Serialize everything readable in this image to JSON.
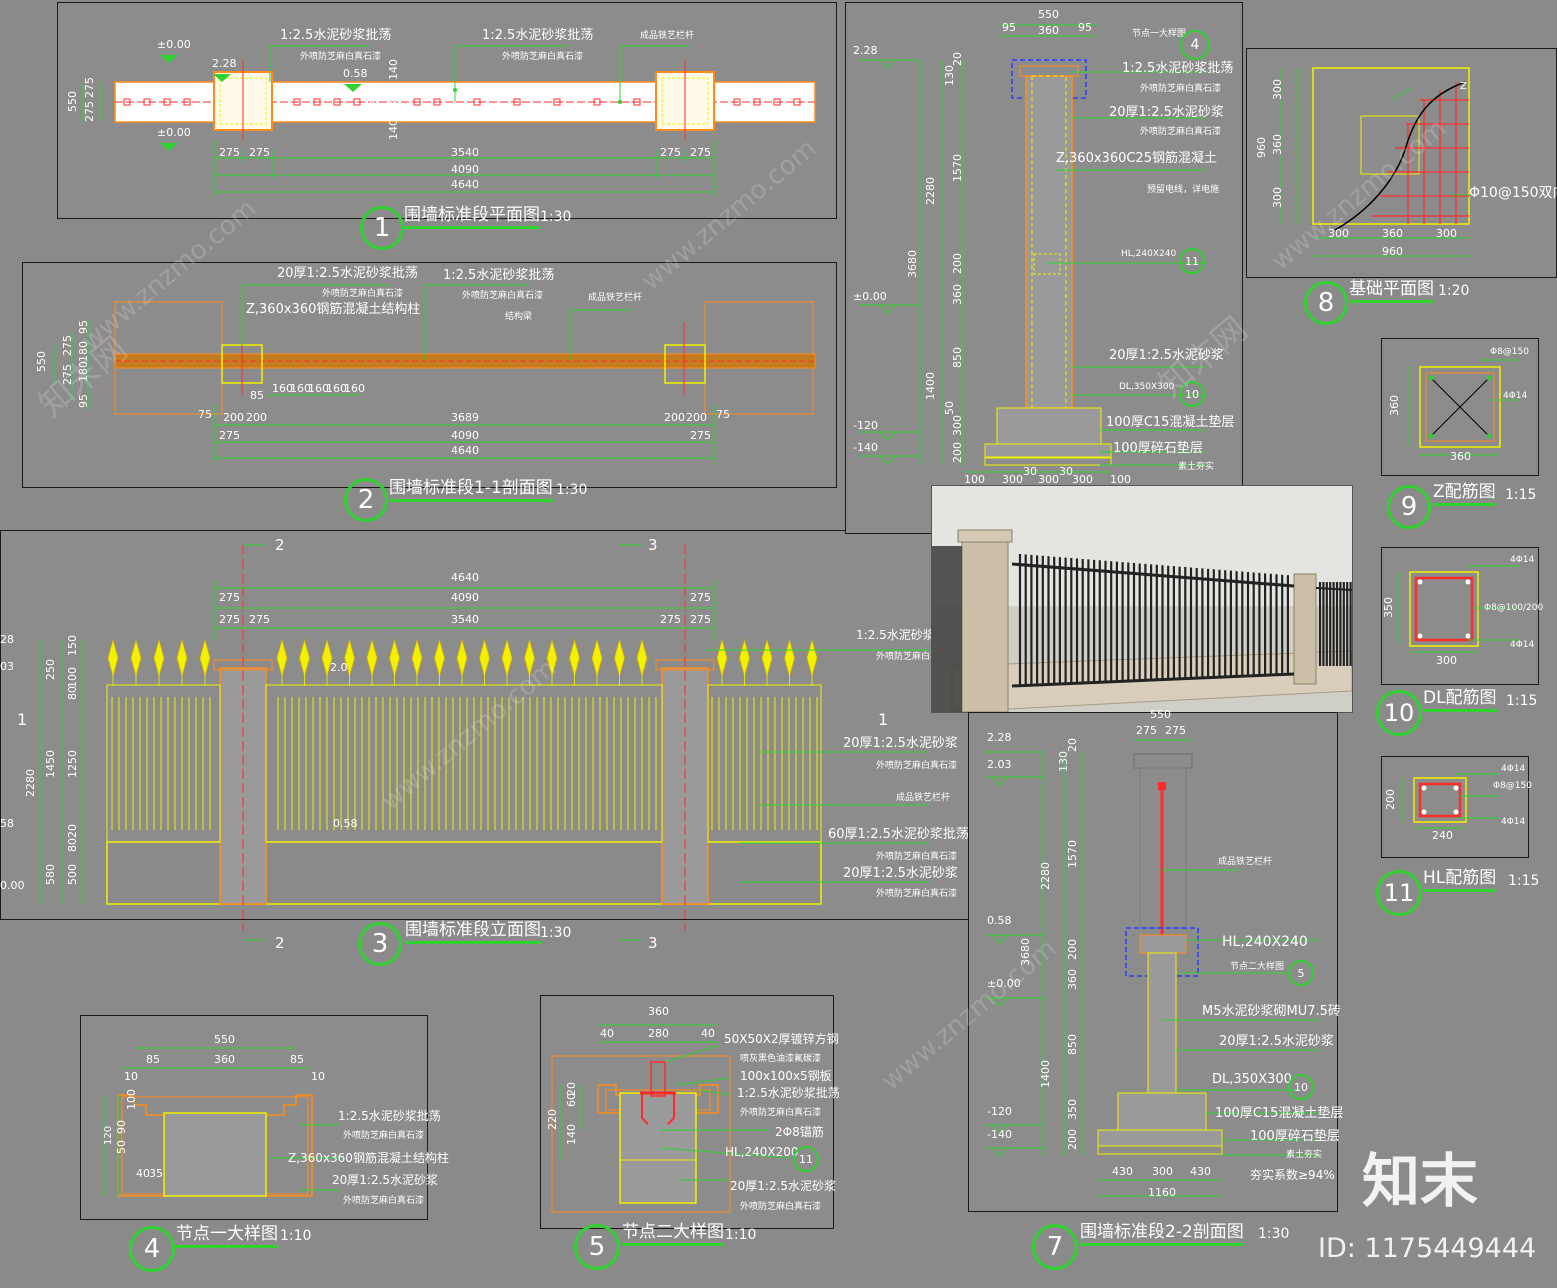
{
  "views": {
    "v1": {
      "number": "1",
      "title": "围墙标准段平面图",
      "scale": "1:30"
    },
    "v2": {
      "number": "2",
      "title": "围墙标准段1-1剖面图",
      "scale": "1:30"
    },
    "v3": {
      "number": "3",
      "title": "围墙标准段立面图",
      "scale": "1:30"
    },
    "v4": {
      "number": "4",
      "title": "节点一大样图",
      "scale": "1:10"
    },
    "v5": {
      "number": "5",
      "title": "节点二大样图",
      "scale": "1:10"
    },
    "v7": {
      "number": "7",
      "title": "围墙标准段2-2剖面图",
      "scale": "1:30"
    },
    "v8": {
      "number": "8",
      "title": "基础平面图",
      "scale": "1:20"
    },
    "v9": {
      "number": "9",
      "title": "Z配筋图",
      "scale": "1:15"
    },
    "v10": {
      "number": "10",
      "title": "DL配筋图",
      "scale": "1:15"
    },
    "v11": {
      "number": "11",
      "title": "HL配筋图",
      "scale": "1:15"
    }
  },
  "plan1": {
    "notes": [
      "1:2.5水泥砂浆批荡",
      "外喷防芝麻白真石漆",
      "1:2.5水泥砂浆批荡",
      "外喷防芝麻白真石漆",
      "成品铁艺栏杆"
    ],
    "levels": [
      "±0.00",
      "2.28",
      "0.58",
      "±0.00"
    ],
    "dims_bottom": [
      "275",
      "275",
      "3540",
      "275",
      "275",
      "4090",
      "4640"
    ],
    "dims_left": [
      "550",
      "275",
      "275"
    ],
    "dims_mid": [
      "140",
      "360",
      "80",
      "140"
    ]
  },
  "sec1": {
    "notes": [
      "20厚1:2.5水泥砂浆批荡",
      "外喷防芝麻白真石漆",
      "Z,360x360钢筋混凝土结构柱",
      "1:2.5水泥砂浆批荡",
      "外喷防芝麻白真石漆",
      "结构梁",
      "成品铁艺栏杆"
    ],
    "dims_left": [
      "550",
      "275",
      "275",
      "95",
      "180",
      "180",
      "95"
    ],
    "dims_bottom": [
      "160",
      "160",
      "160",
      "160",
      "160",
      "85",
      "75",
      "200",
      "200",
      "3689",
      "200",
      "200",
      "75",
      "275",
      "4090",
      "275",
      "4640"
    ]
  },
  "elev3": {
    "cut_marks": [
      "2",
      "3",
      "2",
      "3",
      "1",
      "1"
    ],
    "dims_top": [
      "4640",
      "275",
      "4090",
      "275",
      "275",
      "275",
      "3540",
      "275",
      "275"
    ],
    "dims_left": [
      "28",
      "03",
      "250",
      "150",
      "100",
      "80",
      "1450",
      "1250",
      "20",
      "80",
      "2280",
      "580",
      "500",
      "58",
      "0.00"
    ],
    "levels": [
      "2.0",
      "0.58"
    ],
    "notes": [
      "1:2.5水泥砂浆",
      "外喷防芝麻白石",
      "20厚1:2.5水泥砂浆",
      "外喷防芝麻白真石漆",
      "成品铁艺栏杆",
      "60厚1:2.5水泥砂浆批荡",
      "外喷防芝麻白真石漆",
      "20厚1:2.5水泥砂浆",
      "外喷防芝麻白真石漆"
    ]
  },
  "sec7top": {
    "dims_top": [
      "550",
      "95",
      "360",
      "95"
    ],
    "levels": [
      "2.28",
      "±0.00",
      "-120",
      "-140"
    ],
    "dims_left": [
      "130",
      "20",
      "1570",
      "2280",
      "3680",
      "200",
      "360",
      "850",
      "1400",
      "50",
      "300",
      "200"
    ],
    "dims_bottom": [
      "100",
      "300",
      "300",
      "300",
      "100",
      "30",
      "30"
    ],
    "notes": [
      "节点一大样图",
      "1:2.5水泥砂浆批荡",
      "外喷防芝麻白真石漆",
      "20厚1:2.5水泥砂浆",
      "外喷防芝麻白真石漆",
      "Z,360x360C25钢筋混凝土",
      "预留电线，详电施",
      "HL,240X240",
      "20厚1:2.5水泥砂浆",
      "DL,350X300",
      "100厚C15混凝土垫层",
      "100厚碎石垫层",
      "素土夯实"
    ],
    "tags": [
      "4",
      "11",
      "10"
    ]
  },
  "found8": {
    "dims_left": [
      "960",
      "300",
      "360",
      "300"
    ],
    "dims_bottom": [
      "300",
      "360",
      "300",
      "960"
    ],
    "note": "Φ10@150双向",
    "z": "Z"
  },
  "rebar9": {
    "notes": [
      "Φ8@150",
      "4Φ14"
    ],
    "dims": [
      "360",
      "360"
    ]
  },
  "rebar10": {
    "notes": [
      "4Φ14",
      "Φ8@100/200",
      "4Φ14"
    ],
    "dims": [
      "350",
      "300"
    ]
  },
  "rebar11": {
    "notes": [
      "4Φ14",
      "Φ8@150",
      "4Φ14"
    ],
    "dims": [
      "200",
      "240"
    ]
  },
  "sec22": {
    "dims_top": [
      "550",
      "275",
      "275"
    ],
    "levels": [
      "2.28",
      "2.03",
      "0.58",
      "±0.00",
      "-120",
      "-140"
    ],
    "dims_left": [
      "130",
      "20",
      "1570",
      "2280",
      "3680",
      "200",
      "360",
      "850",
      "1400",
      "350",
      "200"
    ],
    "dims_bottom": [
      "430",
      "300",
      "430",
      "1160"
    ],
    "notes": [
      "成品铁艺栏杆",
      "HL,240X240",
      "节点二大样图",
      "M5水泥砂浆砌MU7.5砖",
      "20厚1:2.5水泥砂浆",
      "DL,350X300",
      "100厚C15混凝土垫层",
      "100厚碎石垫层",
      "素土夯实",
      "夯实系数≥94%"
    ],
    "tags": [
      "5",
      "10"
    ]
  },
  "node4": {
    "dims_top": [
      "550",
      "85",
      "360",
      "85",
      "10",
      "10"
    ],
    "dims_left": [
      "100",
      "90",
      "120",
      "50",
      "40",
      "35"
    ],
    "notes": [
      "1:2.5水泥砂浆批荡",
      "外喷防芝麻白真石漆",
      "Z,360x360钢筋混凝土结构柱",
      "20厚1:2.5水泥砂浆",
      "外喷防芝麻白真石漆"
    ]
  },
  "node5": {
    "dims_top": [
      "360",
      "40",
      "280",
      "40"
    ],
    "dims_left": [
      "220",
      "140",
      "60",
      "20"
    ],
    "notes": [
      "50X50X2厚镀锌方钢",
      "喷灰黑色油漆氟碳漆",
      "100x100x5钢板",
      "1:2.5水泥砂浆批荡",
      "外喷防芝麻白真石漆",
      "2Φ8锚筋",
      "HL,240X200",
      "20厚1:2.5水泥砂浆",
      "外喷防芝麻白真石漆"
    ],
    "tag": "11"
  },
  "branding": {
    "watermark": "www.znzmo.com",
    "watermark_cn": "知末网",
    "logo": "知末",
    "id_label": "ID: 1175449444"
  },
  "colors": {
    "accent_green": "#2fd22f",
    "yellow": "#f1f100",
    "orange": "#ff8c1a",
    "red": "#ff2b2b",
    "blue": "#2a3cff"
  }
}
